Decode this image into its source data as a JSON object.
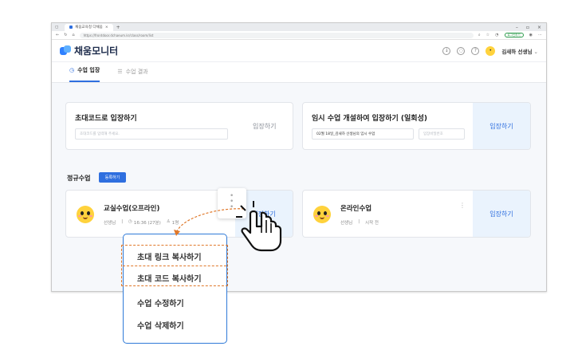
{
  "browser": {
    "tab_title": "채움교육청 다채움",
    "url": "https://frontdoor.dchaeum.kr/class/room/list",
    "pill_label": "로그인하기"
  },
  "app": {
    "logo_text": "채움모니터",
    "user_name": "김새하 선생님",
    "user_suffix": "선생님",
    "help": "?"
  },
  "tabs": [
    {
      "label": "수업 입장"
    },
    {
      "label": "수업 결과"
    }
  ],
  "invite_card": {
    "title": "초대코드로 입장하기",
    "placeholder": "초대코드를 입력해 주세요.",
    "button": "입장하기"
  },
  "temp_card": {
    "title": "임시 수업 개설하여 입장하기 (일회성)",
    "class_name_value": "02월 18일_김새하 선생님의 임시 수업",
    "password_placeholder": "입장비밀번호",
    "button": "입장하기"
  },
  "regular": {
    "section_label": "정규수업",
    "register_button": "등록하기"
  },
  "classes": [
    {
      "name": "교실수업(오프라인)",
      "teacher": "선생님",
      "time": "16:36 (27분)",
      "count": "1명",
      "button": "입장하기"
    },
    {
      "name": "온라인수업",
      "teacher": "선생님",
      "status": "시작 전",
      "button": "입장하기"
    }
  ],
  "context_menu": {
    "items": [
      "초대 링크 복사하기",
      "초대 코드 복사하기",
      "수업 수정하기",
      "수업 삭제하기"
    ]
  },
  "colors": {
    "accent": "#2f6fdf",
    "callout_border": "#2f7ad8",
    "highlight_dash": "#e0782a",
    "avatar": "#ffd23c"
  }
}
